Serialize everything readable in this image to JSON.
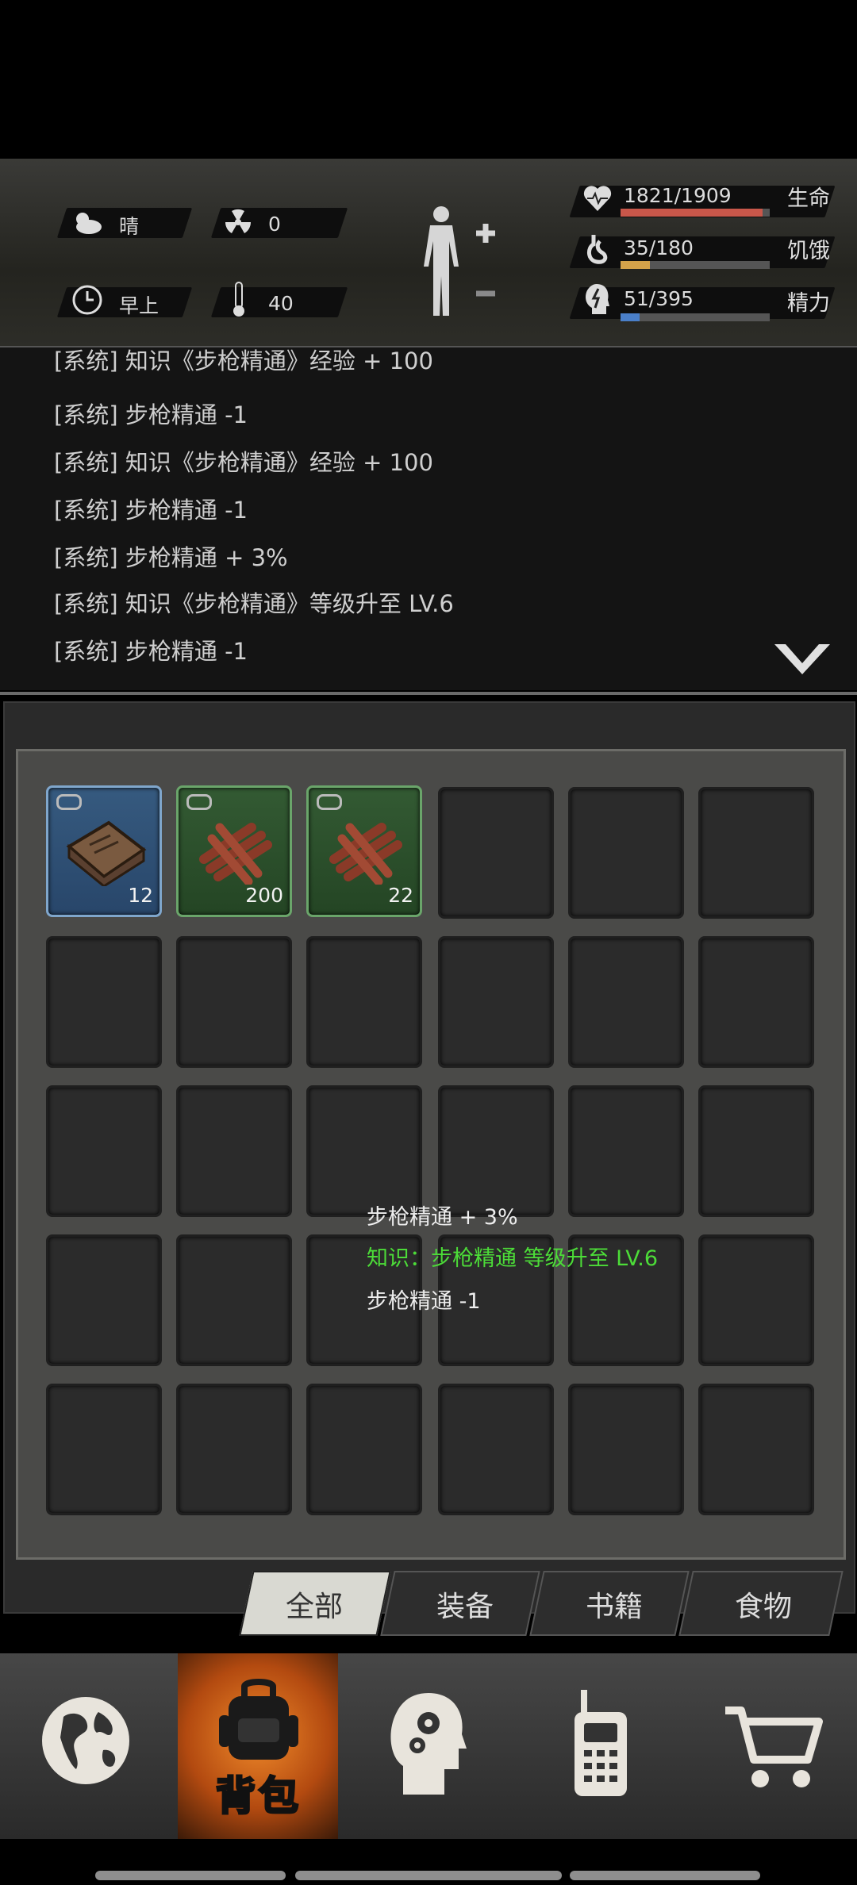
{
  "status": {
    "weather": "晴",
    "radiation": "0",
    "time_of_day": "早上",
    "temperature": "40",
    "health": {
      "label": "生命",
      "text": "1821/1909",
      "value": 1821,
      "max": 1909,
      "color": "#c9574a"
    },
    "hunger": {
      "label": "饥饿",
      "text": "35/180",
      "value": 35,
      "max": 180,
      "color": "#d4a24a"
    },
    "energy": {
      "label": "精力",
      "text": "51/395",
      "value": 51,
      "max": 395,
      "color": "#4a7fc9"
    }
  },
  "log": [
    "[系统] 知识《步枪精通》经验 + 100",
    "[系统] 步枪精通 -1",
    "[系统] 知识《步枪精通》经验 + 100",
    "[系统] 步枪精通 -1",
    "[系统] 步枪精通 + 3%",
    "[系统] 知识《步枪精通》等级升至 LV.6",
    "[系统] 步枪精通 -1"
  ],
  "inventory": {
    "items": [
      {
        "name": "book",
        "count": "12",
        "rarity": "blue"
      },
      {
        "name": "wood",
        "count": "200",
        "rarity": "green"
      },
      {
        "name": "wood",
        "count": "22",
        "rarity": "green"
      }
    ]
  },
  "toast": {
    "line1": "步枪精通 + 3%",
    "line2": "知识：步枪精通 等级升至 LV.6",
    "line3": "步枪精通 -1",
    "highlight_color": "#4cdc38"
  },
  "tabs": [
    "全部",
    "装备",
    "书籍",
    "食物"
  ],
  "nav": {
    "active_label": "背包"
  }
}
